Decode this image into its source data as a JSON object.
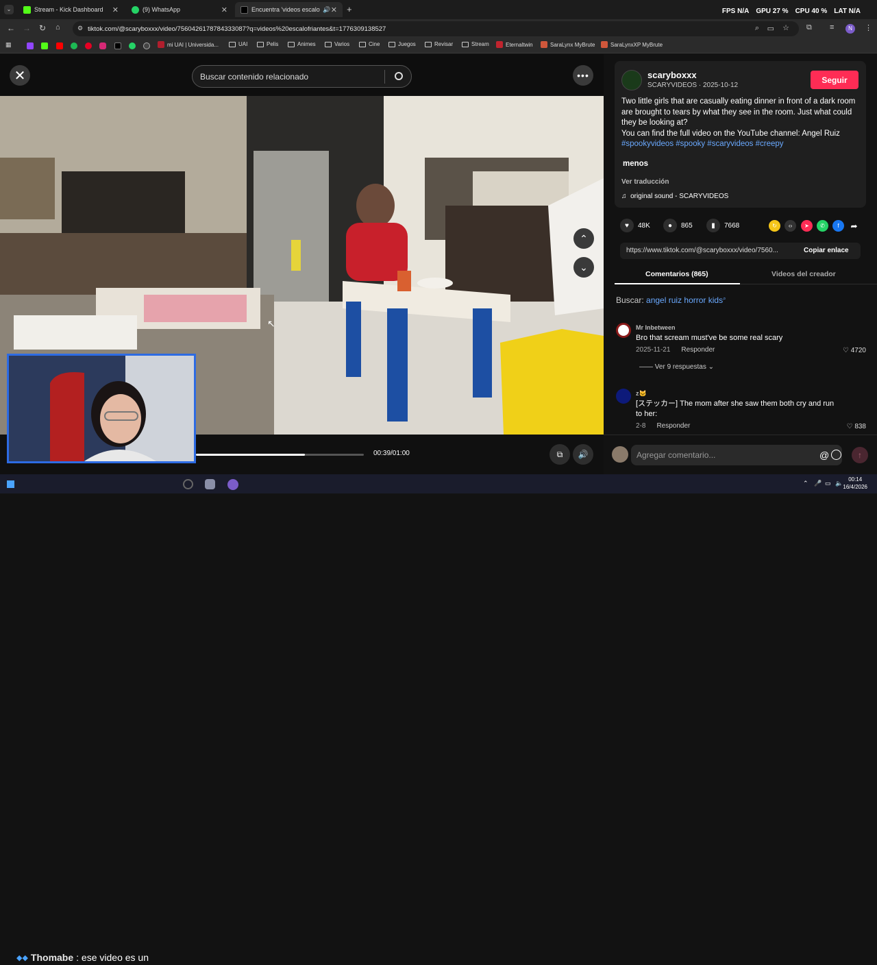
{
  "browser": {
    "tabs": [
      {
        "label": "Stream - Kick Dashboard",
        "color": "#53fc18"
      },
      {
        "label": "(9) WhatsApp",
        "color": "#25d366"
      },
      {
        "label": "Encuentra 'videos escalofri",
        "color": "#000000"
      }
    ],
    "url": "tiktok.com/@scaryboxxx/video/7560426178784333087?q=videos%20escalofriantes&t=1776309138527",
    "bookmarks": [
      "mi UAI | Universida...",
      "UAI",
      "Pelis",
      "Animes",
      "Varios",
      "Cine",
      "Juegos",
      "Revisar",
      "Stream",
      "Eternaltwin",
      "SaraLynx MyBrute",
      "SaraLynxXP MyBrute"
    ],
    "perf": {
      "fps_label": "FPS",
      "fps": "N/A",
      "gpu_label": "GPU",
      "gpu": "27 %",
      "cpu_label": "CPU",
      "cpu": "40 %",
      "lat_label": "LAT",
      "lat": "N/A"
    }
  },
  "viewer": {
    "search_placeholder": "Buscar contenido relacionado",
    "time": "00:39/01:00",
    "progress": 0.65
  },
  "post": {
    "username": "scaryboxxx",
    "subline": "SCARYVIDEOS · 2025-10-12",
    "follow_label": "Seguir",
    "description": "Two little girls that are casually eating dinner in front of a dark room are brought to tears by what they see in the room. Just what could they be looking at?",
    "description2": "You can find the full video on the YouTube channel: Angel Ruiz",
    "hashtags": "#spookyvideos #spooky #scaryvideos #creepy",
    "less_label": "menos",
    "translate_label": "Ver traducción",
    "sound": "original sound - SCARYVIDEOS",
    "likes": "48K",
    "comments": "865",
    "saves": "7668",
    "link": "https://www.tiktok.com/@scaryboxxx/video/7560...",
    "copy_label": "Copiar enlace"
  },
  "tabs": {
    "comments": "Comentarios (865)",
    "videos": "Videos del creador"
  },
  "search_related": {
    "label": "Buscar:",
    "query": "angel ruiz horror kids"
  },
  "comments": [
    {
      "name": "Mr Inbetween",
      "text": "Bro that scream must've be some real scary",
      "date": "2025-11-21",
      "reply": "Responder",
      "likes": "4720",
      "replies": "Ver 9 respuestas"
    },
    {
      "name": "z🐱",
      "text": "[ステッカー] The mom after she saw them both cry and run to her:",
      "date": "2-8",
      "reply": "Responder",
      "likes": "838"
    }
  ],
  "comment_bar": {
    "placeholder": "Agregar comentario..."
  },
  "taskbar": {
    "chat_user": "Thomabe",
    "chat_text": ": ese video es un",
    "clock_time": "00:14",
    "clock_date": "16/4/2026"
  }
}
